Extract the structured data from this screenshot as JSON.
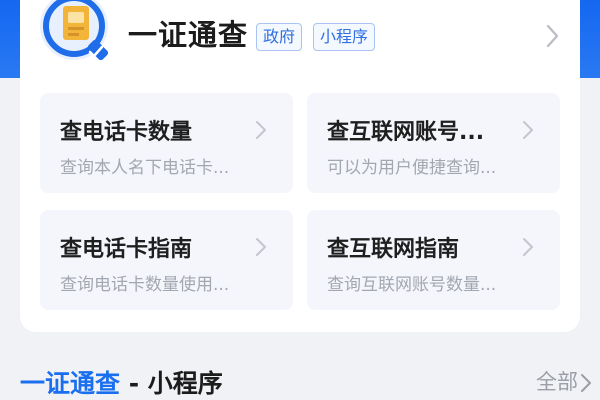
{
  "header": {
    "title": "一证通查",
    "tags": [
      "政府",
      "小程序"
    ]
  },
  "grid": [
    {
      "title": "查电话卡数量",
      "subtitle": "查询本人名下电话卡..."
    },
    {
      "title": "查互联网账号...",
      "subtitle": "可以为用户便捷查询..."
    },
    {
      "title": "查电话卡指南",
      "subtitle": "查询电话卡数量使用..."
    },
    {
      "title": "查互联网指南",
      "subtitle": "查询互联网账号数量..."
    }
  ],
  "section": {
    "title_highlight": "一证通查",
    "title_rest": " - 小程序",
    "see_all": "全部"
  },
  "colors": {
    "brand_blue": "#1a6ef0",
    "tag_blue": "#2f6fe0",
    "card_bg": "#f4f6fb",
    "page_bg": "#f1f2f5"
  },
  "icons": {
    "logo": "id-card-check-logo-icon",
    "chevron": "chevron-right-icon"
  }
}
